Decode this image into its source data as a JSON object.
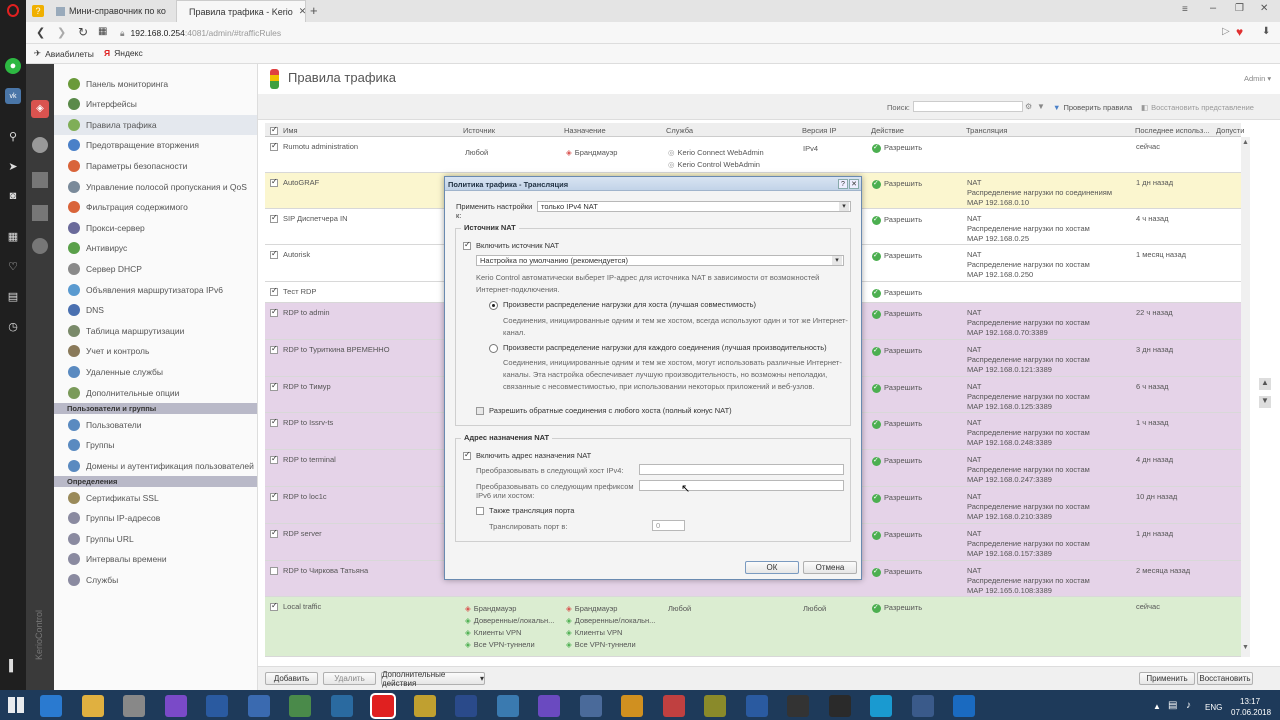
{
  "browser": {
    "tabs": [
      {
        "label": "Мини-справочник по ко"
      },
      {
        "label": "Правила трафика - Kerio"
      }
    ],
    "url_host": "192.168.0.254",
    "url_path": ":4081/admin/#trafficRules",
    "bookmarks": [
      "Авиабилеты",
      "Яндекс"
    ]
  },
  "app": {
    "title": "Правила трафика",
    "user_menu": "Admin",
    "sidebar_brand": "KerioControl",
    "search_label": "Поиск:",
    "check_rules": "Проверить правила",
    "restore_view": "Восстановить представление"
  },
  "nav": {
    "items": [
      {
        "label": "Панель мониторинга",
        "color": "#6a9a3a"
      },
      {
        "label": "Интерфейсы",
        "color": "#5a8a4a"
      },
      {
        "label": "Правила трафика",
        "color": "#7fae57"
      },
      {
        "label": "Предотвращение вторжения",
        "color": "#4a80c8"
      },
      {
        "label": "Параметры безопасности",
        "color": "#d9643a"
      },
      {
        "label": "Управление полосой пропускания и QoS",
        "color": "#7a8a9a"
      },
      {
        "label": "Фильтрация содержимого",
        "color": "#d9643a"
      },
      {
        "label": "Прокси-сервер",
        "color": "#6a6a9a"
      },
      {
        "label": "Антивирус",
        "color": "#5aa04a"
      },
      {
        "label": "Сервер DHCP",
        "color": "#8a8a8a"
      },
      {
        "label": "Объявления маршрутизатора IPv6",
        "color": "#5a9ad0"
      },
      {
        "label": "DNS",
        "color": "#4a70b0"
      },
      {
        "label": "Таблица маршрутизации",
        "color": "#7a8a6a"
      },
      {
        "label": "Учет и контроль",
        "color": "#8a7a5a"
      },
      {
        "label": "Удаленные службы",
        "color": "#5a8ac0"
      },
      {
        "label": "Дополнительные опции",
        "color": "#7a9a5a"
      }
    ],
    "section_users": "Пользователи и группы",
    "users_items": [
      {
        "label": "Пользователи",
        "color": "#5a8ac0"
      },
      {
        "label": "Группы",
        "color": "#5a8ac0"
      },
      {
        "label": "Домены и аутентификация пользователей",
        "color": "#5a8ac0"
      }
    ],
    "section_defs": "Определения",
    "defs_items": [
      {
        "label": "Сертификаты SSL",
        "color": "#9a8a5a"
      },
      {
        "label": "Группы IP-адресов",
        "color": "#8a8aa0"
      },
      {
        "label": "Группы URL",
        "color": "#8a8aa0"
      },
      {
        "label": "Интервалы времени",
        "color": "#8a8aa0"
      },
      {
        "label": "Службы",
        "color": "#8a8aa0"
      }
    ]
  },
  "table": {
    "headers": [
      "Имя",
      "Источник",
      "Назначение",
      "Служба",
      "Версия IP",
      "Действие",
      "Трансляция",
      "Последнее использ...",
      "Допусти"
    ],
    "rows": [
      {
        "name": "Rumotu administration",
        "source": "Любой",
        "dest": "Брандмауэр",
        "service": [
          "Kerio Connect WebAdmin",
          "Kerio Control WebAdmin"
        ],
        "ip": "IPv4",
        "action": "Разрешить",
        "trans": [],
        "last": "сейчас"
      },
      {
        "name": "AutoGRAF",
        "action": "Разрешить",
        "trans": [
          "NAT",
          "Распределение нагрузки по соединениям",
          "MAP 192.168.0.10"
        ],
        "last": "1 дн назад"
      },
      {
        "name": "SIP Диспетчера IN",
        "action": "Разрешить",
        "trans": [
          "NAT",
          "Распределение нагрузки по хостам",
          "MAP 192.168.0.25"
        ],
        "last": "4 ч назад"
      },
      {
        "name": "Autorisk",
        "action": "Разрешить",
        "trans": [
          "NAT",
          "Распределение нагрузки по хостам",
          "MAP 192.168.0.250"
        ],
        "last": "1 месяц назад"
      },
      {
        "name": "Тест RDP",
        "action": "Разрешить",
        "trans": [],
        "last": ""
      },
      {
        "name": "RDP to admin",
        "action": "Разрешить",
        "trans": [
          "NAT",
          "Распределение нагрузки по хостам",
          "MAP 192.168.0.70:3389"
        ],
        "last": "22 ч назад"
      },
      {
        "name": "RDP to Туриткина ВРЕМЕННО",
        "action": "Разрешить",
        "trans": [
          "NAT",
          "Распределение нагрузки по хостам",
          "MAP 192.168.0.121:3389"
        ],
        "last": "3 дн назад"
      },
      {
        "name": "RDP to Тимур",
        "action": "Разрешить",
        "trans": [
          "NAT",
          "Распределение нагрузки по хостам",
          "MAP 192.168.0.125:3389"
        ],
        "last": "6 ч назад"
      },
      {
        "name": "RDP to Issrv-ts",
        "action": "Разрешить",
        "trans": [
          "NAT",
          "Распределение нагрузки по хостам",
          "MAP 192.168.0.248:3389"
        ],
        "last": "1 ч назад"
      },
      {
        "name": "RDP to terminal",
        "action": "Разрешить",
        "trans": [
          "NAT",
          "Распределение нагрузки по хостам",
          "MAP 192.168.0.247:3389"
        ],
        "last": "4 дн назад"
      },
      {
        "name": "RDP to loc1c",
        "action": "Разрешить",
        "trans": [
          "NAT",
          "Распределение нагрузки по хостам",
          "MAP 192.168.0.210:3389"
        ],
        "last": "10 дн назад"
      },
      {
        "name": "RDP server",
        "action": "Разрешить",
        "trans": [
          "NAT",
          "Распределение нагрузки по хостам",
          "MAP 192.168.0.157:3389"
        ],
        "last": "1 дн назад"
      },
      {
        "name": "RDP to Чиркова Татьяна",
        "action": "Разрешить",
        "trans": [
          "NAT",
          "Распределение нагрузки по хостам",
          "MAP 192.165.0.108:3389"
        ],
        "last": "2 месяца назад"
      },
      {
        "name": "Local traffic",
        "source_list": [
          "Брандмауэр",
          "Доверенные/локальн...",
          "Клиенты VPN",
          "Все VPN-туннели"
        ],
        "dest_list": [
          "Брандмауэр",
          "Доверенные/локальн...",
          "Клиенты VPN",
          "Все VPN-туннели"
        ],
        "service": [
          "Любой"
        ],
        "ip": "Любой",
        "action": "Разрешить",
        "trans": [],
        "last": "сейчас"
      }
    ]
  },
  "bottom": {
    "add": "Добавить",
    "delete": "Удалить",
    "more": "Дополнительные действия",
    "apply": "Применить",
    "restore": "Восстановить"
  },
  "dialog": {
    "title": "Политика трафика - Трансляция",
    "apply_label_1": "Применить настройки",
    "apply_label_2": "к:",
    "apply_value": "только IPv4 NAT",
    "src_section": "Источник NAT",
    "src_enable": "Включить источник NAT",
    "src_mode": "Настройка по умолчанию (рекомендуется)",
    "src_desc_1": "Kerio Control автоматически выберет IP-адрес для источника NAT в зависимости от возможностей",
    "src_desc_2": "Интернет-подключения.",
    "radio1": "Произвести распределение нагрузки для хоста (лучшая совместимость)",
    "radio1_desc_1": "Соединения, инициированные одним и тем же хостом, всегда используют один и тот же Интернет-",
    "radio1_desc_2": "канал.",
    "radio2": "Произвести распределение нагрузки для каждого соединения (лучшая производительность)",
    "radio2_desc_1": "Соединения, инициированные одним и тем же хостом, могут использовать различные Интернет-",
    "radio2_desc_2": "каналы. Эта настройка обеспечивает лучшую производительность, но возможны неполадки,",
    "radio2_desc_3": "связанные с несовместимостью, при использовании некоторых приложений и веб-узлов.",
    "reverse": "Разрешить обратные соединения с любого хоста (полный конус NAT)",
    "dst_section": "Адрес назначения NAT",
    "dst_enable": "Включить адрес назначения NAT",
    "host_label": "Преобразовывать в следующий хост IPv4:",
    "host_value": "",
    "prefix_label_1": "Преобразовывать со следующим префиксом",
    "prefix_label_2": "IPv6 или хостом:",
    "prefix_value": "",
    "port_check": "Также трансляция порта",
    "port_label": "Транслировать порт в:",
    "port_value": "0",
    "ok": "ОК",
    "cancel": "Отмена"
  },
  "taskbar": {
    "lang": "ENG",
    "time": "13:17",
    "date": "07.06.2018"
  }
}
